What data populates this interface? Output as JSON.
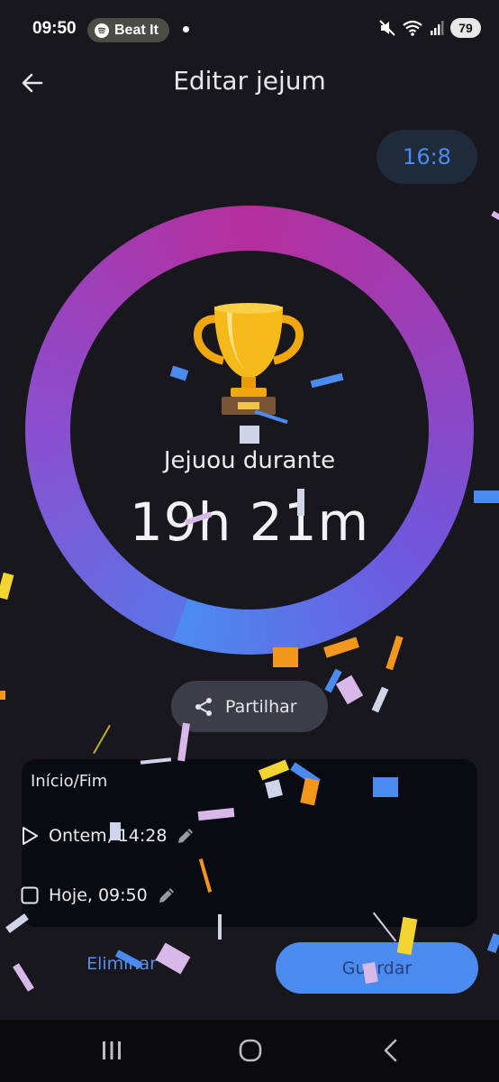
{
  "status_bar": {
    "time": "09:50",
    "media_app_icon": "spotify-icon",
    "media_title": "Beat It",
    "icons": [
      "mute-icon",
      "wifi-icon",
      "signal-icon"
    ],
    "battery": "79"
  },
  "header": {
    "back_icon": "arrow-left-icon",
    "title": "Editar jejum"
  },
  "plan_chip": "16:8",
  "summary": {
    "icon": "trophy-icon",
    "label": "Jejuou durante",
    "duration": "19h 21m"
  },
  "share": {
    "icon": "share-icon",
    "label": "Partilhar"
  },
  "start_end": {
    "title": "Início/Fim",
    "start": {
      "icon": "play-icon",
      "value": "Ontem, 14:28",
      "edit_icon": "pencil-icon"
    },
    "end": {
      "icon": "stop-icon",
      "value": "Hoje, 09:50",
      "edit_icon": "pencil-icon"
    }
  },
  "actions": {
    "delete_label": "Eliminar",
    "save_label": "Guardar"
  },
  "navigation": [
    "recent-apps-icon",
    "home-icon",
    "back-icon"
  ],
  "colors": {
    "background": "#17171d",
    "accent": "#4b8bf0",
    "ring_start": "#b52e9c",
    "ring_end": "#4c8bf0",
    "card": "#080b12"
  }
}
